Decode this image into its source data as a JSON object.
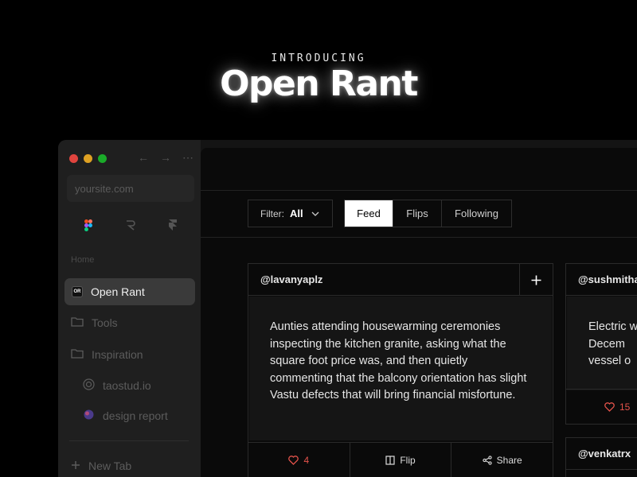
{
  "hero": {
    "kicker": "INTRODUCING",
    "title": "Open Rant"
  },
  "browser": {
    "url": "yoursite.com",
    "traffic_colors": [
      "#e0443e",
      "#dea123",
      "#1aab29"
    ]
  },
  "sidebar": {
    "section_label": "Home",
    "active_item": {
      "badge": "OR",
      "label": "Open Rant"
    },
    "folders": [
      {
        "icon": "folder-icon",
        "label": "Tools"
      },
      {
        "icon": "folder-icon",
        "label": "Inspiration"
      }
    ],
    "links": [
      {
        "icon": "globe-icon",
        "label": "taostud.io"
      },
      {
        "icon": "planet-icon",
        "label": "design report"
      }
    ],
    "new_tab": "New Tab"
  },
  "filter": {
    "label": "Filter:",
    "value": "All"
  },
  "tabs": [
    {
      "label": "Feed",
      "active": true
    },
    {
      "label": "Flips",
      "active": false
    },
    {
      "label": "Following",
      "active": false
    }
  ],
  "cards": [
    {
      "user": "@lavanyaplz",
      "body": "Aunties attending housewarming ceremonies inspecting the kitchen granite, asking what the square foot price was, and then quietly commenting that the balcony orientation has slight Vastu defects that will bring financial misfortune.",
      "likes": "4",
      "flip_label": "Flip",
      "share_label": "Share"
    },
    {
      "user": "@sushmithav",
      "body": "Electric w of Decem vessel o",
      "likes": "15"
    },
    {
      "user": "@venkatrx"
    }
  ],
  "colors": {
    "accent_like": "#e5534b",
    "background": "#000000"
  }
}
